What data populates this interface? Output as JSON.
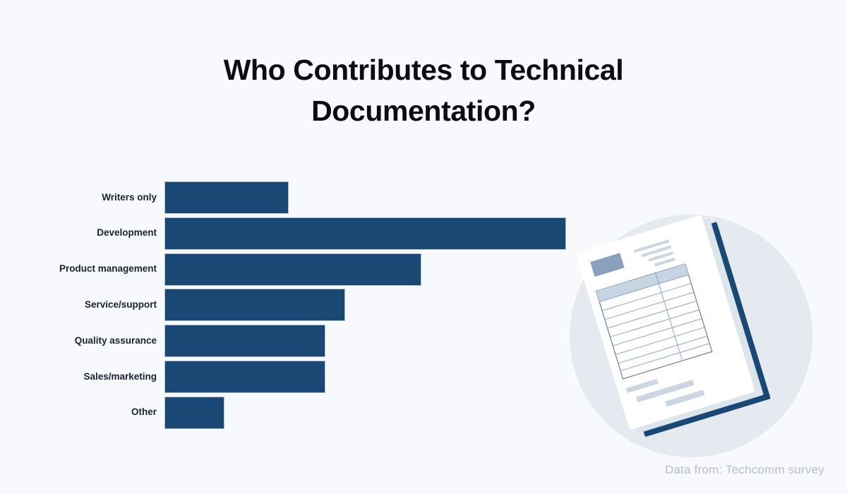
{
  "background_color": "#f7f9fc",
  "accent_color": "#1a4875",
  "label_color": "#1b2133",
  "source_color": "#b9bec6",
  "title": "Who Contributes to Technical Documentation?",
  "title_line1": "Who Contributes to Technical",
  "title_line2": "Documentation?",
  "source_note": "Data from: Techcomm survey",
  "illustration": {
    "name": "tilted-document-with-table",
    "circle_color": "#e4eaef",
    "paper_color": "#ffffff",
    "paper_shadow_color": "#e1e8ee",
    "spine_color": "#1a4875",
    "table_line_color": "#6d86b5",
    "header_fill_color": "#c7d4e2",
    "logo_block_color": "#8aa0bd",
    "text_line_color": "#ccd6e2"
  },
  "chart_data": {
    "type": "bar",
    "orientation": "horizontal",
    "title": "Who Contributes to Technical Documentation?",
    "xlabel": "",
    "ylabel": "",
    "grid": false,
    "legend": null,
    "xlim": [
      0,
      100
    ],
    "bar_color": "#1a4875",
    "bar_edge_color": "#aebfd2",
    "categories": [
      "Writers only",
      "Development",
      "Product management",
      "Service/support",
      "Quality assurance",
      "Sales/marketing",
      "Other"
    ],
    "values": [
      31,
      100,
      64,
      45,
      40,
      40,
      15
    ],
    "value_unit": "percent-of-max",
    "max_value": 100
  }
}
